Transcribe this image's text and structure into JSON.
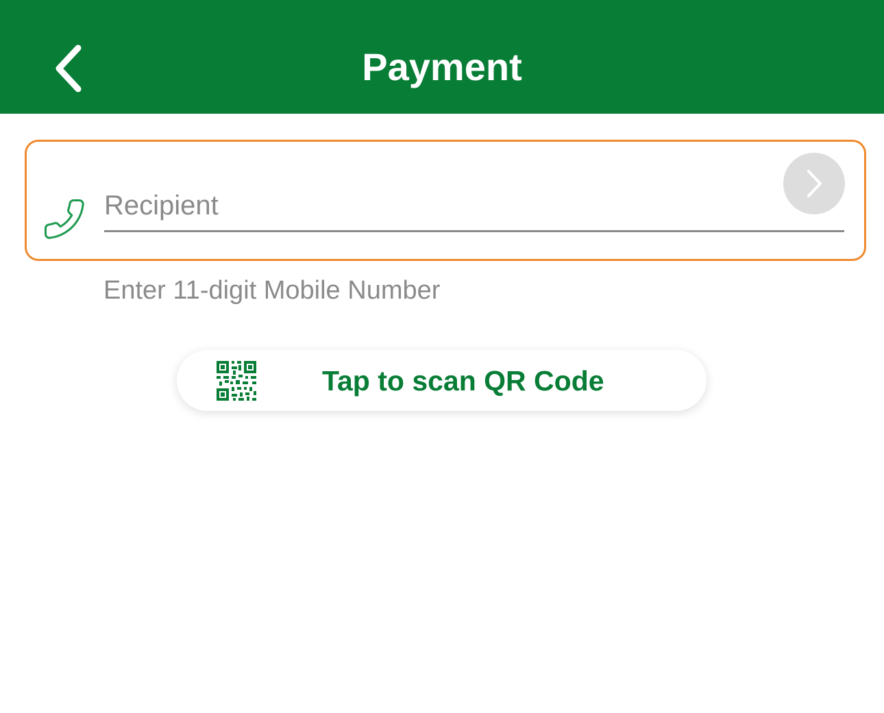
{
  "colors": {
    "header_bg": "#087d36",
    "accent_green": "#087d36",
    "focus_border": "#f08a2e",
    "hint_gray": "#8a8a8a",
    "go_button_bg": "#dddddd"
  },
  "header": {
    "title": "Payment",
    "back_icon": "chevron-left-icon"
  },
  "recipient": {
    "placeholder": "Recipient",
    "value": "",
    "leading_icon": "phone-icon",
    "go_icon": "chevron-right-icon",
    "hint": "Enter 11-digit Mobile Number"
  },
  "scan": {
    "icon": "qr-code-icon",
    "label": "Tap to scan QR Code"
  }
}
